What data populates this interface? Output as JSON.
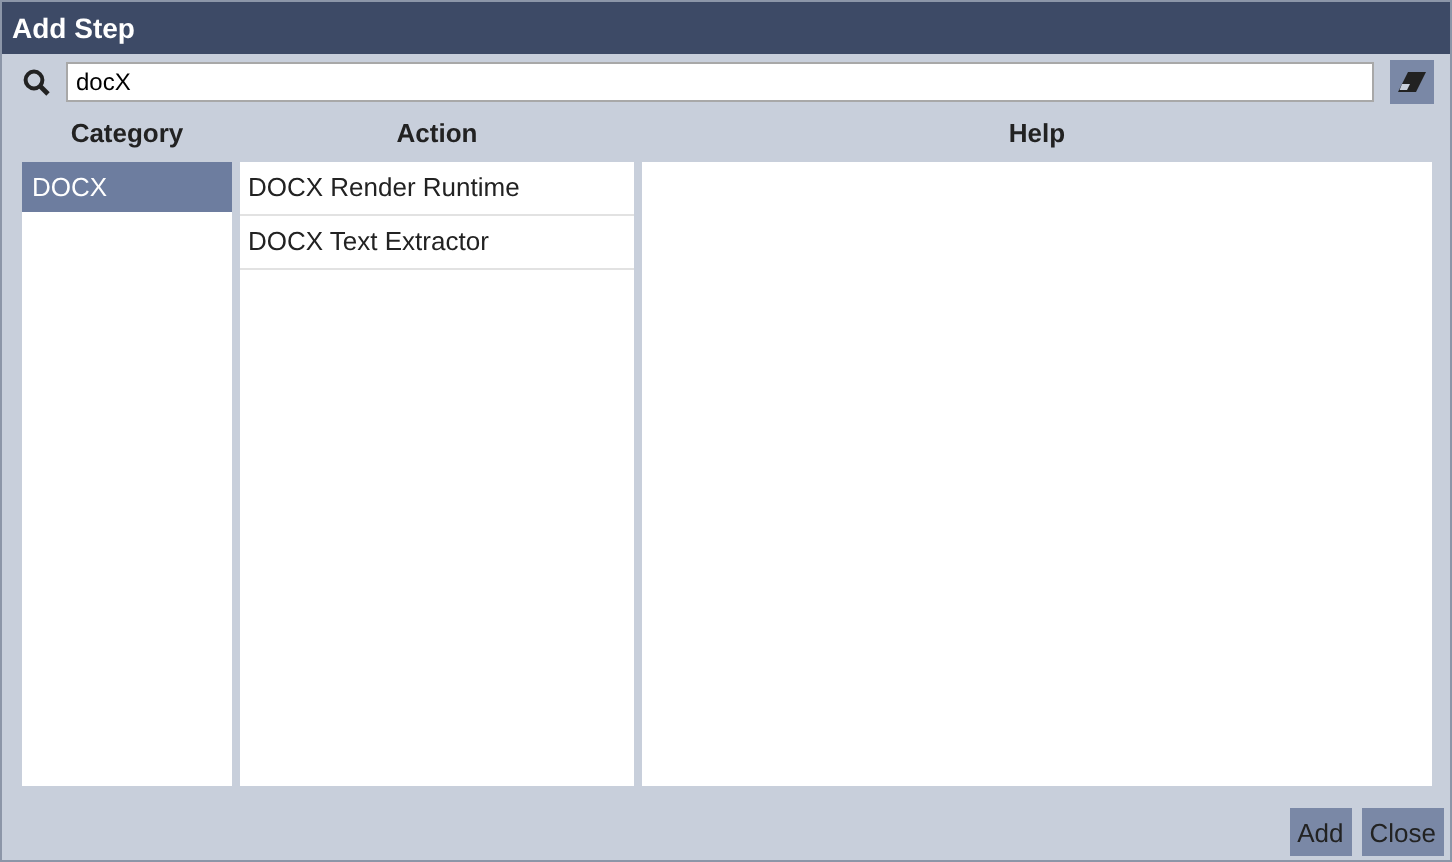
{
  "window": {
    "title": "Add Step"
  },
  "search": {
    "value": "docX"
  },
  "columns": [
    "Category",
    "Action",
    "Help"
  ],
  "categories": [
    {
      "label": "DOCX",
      "selected": true
    }
  ],
  "actions": [
    {
      "label": "DOCX Render Runtime",
      "selected": false
    },
    {
      "label": "DOCX Text Extractor",
      "selected": false
    }
  ],
  "buttons": [
    "Add",
    "Close"
  ]
}
